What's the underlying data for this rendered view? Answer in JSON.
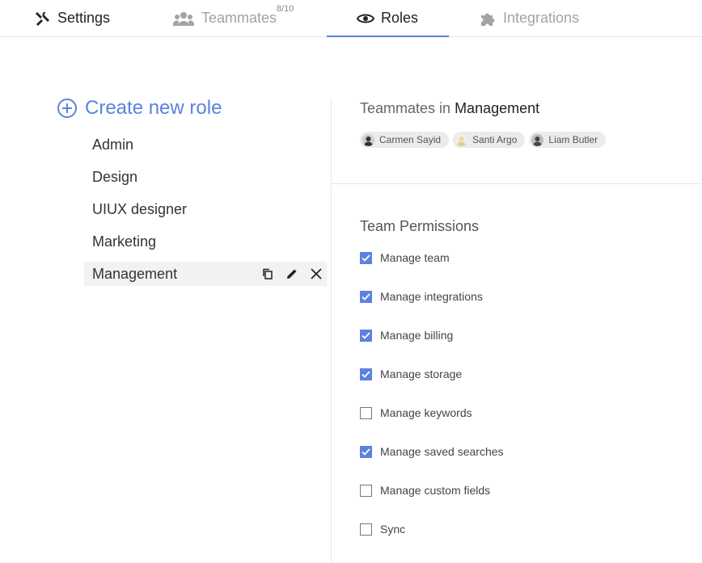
{
  "tabs": [
    {
      "label": "Settings",
      "icon": "tools-icon"
    },
    {
      "label": "Teammates",
      "icon": "people-icon",
      "badge": "8/10"
    },
    {
      "label": "Roles",
      "icon": "eye-icon"
    },
    {
      "label": "Integrations",
      "icon": "puzzle-icon"
    }
  ],
  "create_role": "Create new role",
  "roles": [
    "Admin",
    "Design",
    "UIUX designer",
    "Marketing",
    "Management"
  ],
  "selected_role": "Management",
  "teammates_prefix": "Teammates in",
  "teammates_role": "Management",
  "members": [
    {
      "name": "Carmen Sayid"
    },
    {
      "name": "Santi Argo"
    },
    {
      "name": "Liam Butler"
    }
  ],
  "permissions_title": "Team Permissions",
  "permissions": [
    {
      "label": "Manage team",
      "checked": true
    },
    {
      "label": "Manage integrations",
      "checked": true
    },
    {
      "label": "Manage billing",
      "checked": true
    },
    {
      "label": "Manage storage",
      "checked": true
    },
    {
      "label": "Manage keywords",
      "checked": false
    },
    {
      "label": "Manage saved searches",
      "checked": true
    },
    {
      "label": "Manage custom fields",
      "checked": false
    },
    {
      "label": "Sync",
      "checked": false
    }
  ],
  "colors": {
    "accent": "#5b82e0"
  }
}
